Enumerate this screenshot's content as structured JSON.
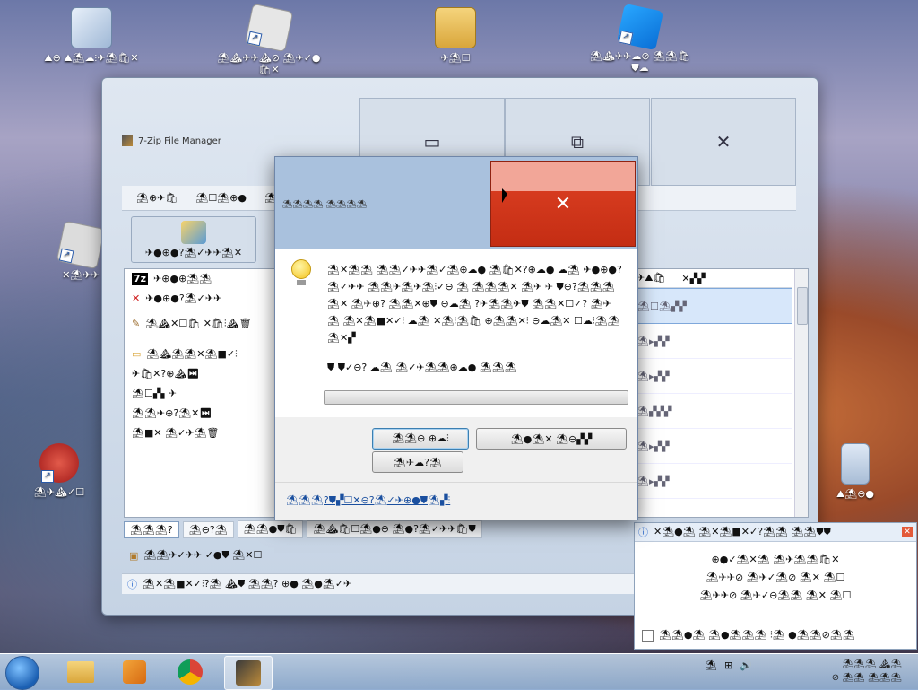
{
  "desktop": {
    "icons": [
      {
        "label": "⛰⊖ ⛰⛱☁⫶✈⛱🛍✕"
      },
      {
        "label": "⛱⛰✈✈⛰⊘ ⛱✈✓●🛍✕"
      },
      {
        "label": "✈⛱☐"
      },
      {
        "label": "⛱⛰✈✈☁⊘ ⛱⛱🛍⛊☁"
      },
      {
        "label": "✕⛱✈✈"
      },
      {
        "label": "⛱✈⛰✓☐"
      },
      {
        "label": "⛰⛱⊖●"
      }
    ]
  },
  "main_window": {
    "title": "7-Zip File Manager",
    "min_glyph": "▭",
    "max_glyph": "⧉",
    "close_glyph": "✕",
    "menu": [
      "⛱⊕✈🛍",
      "⛱☐⛱⊕●",
      "⛱"
    ],
    "toolbar_label": "✈●⊕●?⛱✓✈✈⛱✕",
    "left_items": [
      {
        "text": "✈⊕●⊕⛱⛱"
      },
      {
        "text": "✈●⊕●?⛱✓✈✈"
      },
      {
        "text": "⛱⛰✕☐🛍 ✕🛍⫶⛰🗑"
      },
      {
        "text": "⛱⛰⛱⛱✕⛱■✓⫶"
      },
      {
        "text": "✈🛍✕?⊕⛰⏭"
      },
      {
        "text": "⛱☐▞▖✈"
      },
      {
        "text": "⛱⛱✈⊕?⛱✕⏭"
      },
      {
        "text": "⛱■✕ ⛱✓✈⛱🗑"
      }
    ],
    "grid_headers": [
      "✈⛰🛍",
      "✕▞▞"
    ],
    "grid_rows": [
      {
        "text": "⛱☐⛱▞▞"
      },
      {
        "text": "⛱▸▞▞"
      },
      {
        "text": "⛱▸▞▞"
      },
      {
        "text": "⛱▞▞▞"
      },
      {
        "text": "⛱▸▞▞"
      },
      {
        "text": "⛱▸▞▞"
      },
      {
        "text": "⛱▸▞▞"
      }
    ],
    "tabs": [
      "⛱⛱⛱?",
      "⛱⊖?⛱",
      "⛱⛱●⛊🛍",
      "⛱⛰🛍☐⛱●⊖ ⛱●?⛱✓✈✈🛍⛊"
    ],
    "sub_label": "⛱⛱✈✓✈✈ ✓●⛊ ⛱✕☐",
    "status_text": "⛱✕⛱■✕✓⫶?⛱ ⛰⛊ ⛱⛱? ⊕● ⛱●⛱✓✈"
  },
  "side_panel": {
    "header": "✕⛱●⛱ ⛱✕⛱■✕✓?⛱⛱ ⛱⛱⛊⛊",
    "lines": [
      "⊕●✓⛱✕⛱ ⛱✈⛱⛱🛍✕",
      "⛱✈✈⊘ ⛱✈✓⛱⊘ ⛱✕ ⛱☐",
      "⛱✈✈⊘ ⛱✈✓⊖⛱⛱ ⛱✕ ⛱☐"
    ],
    "checkbox_label": "⛱⛱●⛱ ⛱●⛱⛱⛱ ⫶⛱ ●⛱⛱⊘⛱⛱"
  },
  "dialog": {
    "title": "⛱⛱⛱⛱ ⛱⛱⛱⛱",
    "close_glyph": "✕",
    "message": "⛱✕⛱⛱ ⛱⛱✓✈✈⛱✓⛱⊕☁● ⛱🛍✕?⊕☁● ☁⛱ ✈●⊕●?⛱✓✈✈ ⛱⛱✈⛱✈⛱⫶✓⊖ ⛱ ⛱⛱⛱✕ ⛱✈ ✈ ⛊⊖?⛱⛱⛱⛱✕ ⛱✈⊕? ⛱⛱✕⊕⛊ ⊖☁⛱ ?✈⛱⛱✈⛊ ⛱⛱✕☐✓? ⛱✈⛱ ⛱✕⛱■✕✓⫶ ☁⛱ ✕⛱⫶⛱🛍 ⊕⛱⛱✕⫶ ⊖☁⛱✕ ☐☁⫶⛱⛱⛱✕▞",
    "sub_message": "⛊ ⛊✓⊖? ☁⛱ ⛱✓✈⛱⛱⊕☁● ⛱⛱⛱",
    "btn_ok": "⛱⛱⊖ ⊕☁⫶",
    "btn_back": "⛱●⛱✕ ⛱⊖▞▞",
    "btn_cancel": "⛱✈☁?⛱",
    "link": "⛱⛱⛱?⛊▞☐✕⊖?⛱✓✈⊕●⛊⛱▞⫶"
  },
  "taskbar": {
    "tray_lang": "⛱",
    "clock_time": "⛱⛱⛱ ⛰⛱",
    "clock_date": "⊘ ⛱⛱ ⛱⛱⛱"
  }
}
